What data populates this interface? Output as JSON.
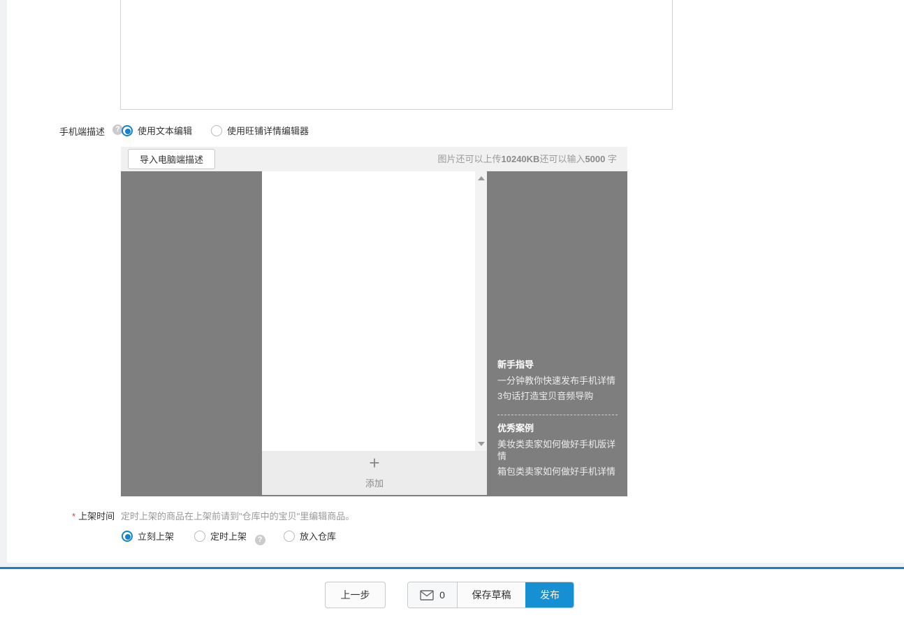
{
  "pc_description": {
    "value": ""
  },
  "mobile_desc": {
    "label": "手机端描述",
    "help_icon": "?",
    "options": [
      {
        "label": "使用文本编辑",
        "selected": true
      },
      {
        "label": "使用旺铺详情编辑器",
        "selected": false
      }
    ],
    "toolbar": {
      "import_button": "导入电脑端描述",
      "upload_info_prefix": "图片还可以上传",
      "upload_info_size": "10240KB",
      "upload_info_middle": "还可以输入",
      "upload_info_count": "5000",
      "upload_info_suffix": " 字"
    },
    "preview": {
      "add_icon": "+",
      "add_label": "添加",
      "guide": {
        "title": "新手指导",
        "items": [
          "一分钟教你快速发布手机详情",
          "3句话打造宝贝音频导购"
        ]
      },
      "cases": {
        "title": "优秀案例",
        "items": [
          "美妆类卖家如何做好手机版详情",
          "箱包类卖家如何做好手机详情"
        ]
      }
    }
  },
  "shelf_time": {
    "required_mark": "*",
    "label": "上架时间",
    "hint": "定时上架的商品在上架前请到\"仓库中的宝贝\"里编辑商品。",
    "help_icon": "?",
    "options": [
      {
        "label": "立刻上架",
        "selected": true
      },
      {
        "label": "定时上架",
        "selected": false
      },
      {
        "label": "放入仓库",
        "selected": false
      }
    ]
  },
  "footer": {
    "prev_button": "上一步",
    "draft_count": "0",
    "save_draft_button": "保存草稿",
    "publish_button": "发布"
  },
  "colors": {
    "accent_blue": "#168fd3",
    "radio_blue": "#1283cc",
    "divider_blue": "#1383c6",
    "preview_gray": "#7e7e7e"
  }
}
